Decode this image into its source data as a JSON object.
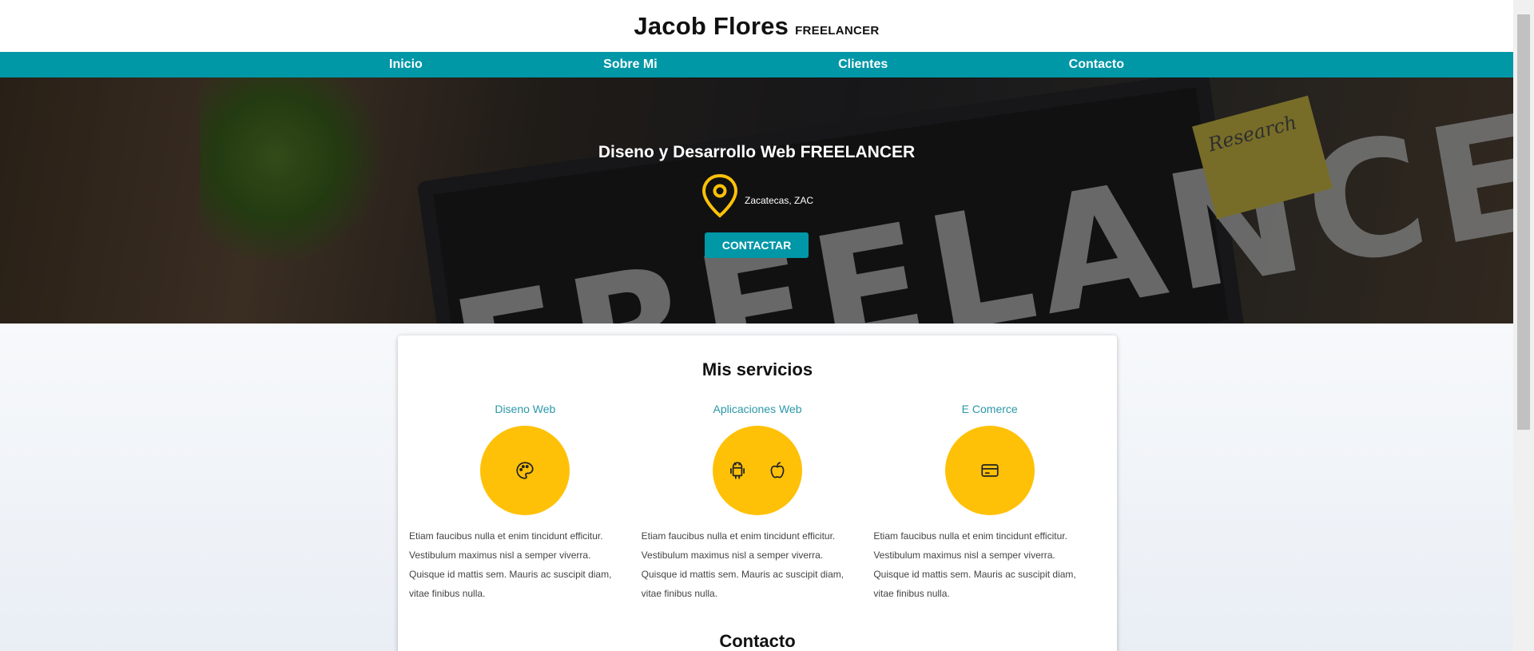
{
  "header": {
    "name": "Jacob Flores",
    "tag": "FREELANCER"
  },
  "nav": {
    "items": [
      "Inicio",
      "Sobre Mi",
      "Clientes",
      "Contacto"
    ]
  },
  "hero": {
    "title": "Diseno y Desarrollo Web FREELANCER",
    "location": "Zacatecas, ZAC",
    "cta": "CONTACTAR",
    "background_word": "FREELANCE",
    "note_word": "Research"
  },
  "services": {
    "title": "Mis servicios",
    "items": [
      {
        "title": "Diseno Web",
        "icons": [
          "palette-icon"
        ],
        "text": "Etiam faucibus nulla et enim tincidunt efficitur. Vestibulum maximus nisl a semper viverra. Quisque id mattis sem. Mauris ac suscipit diam, vitae finibus nulla."
      },
      {
        "title": "Aplicaciones Web",
        "icons": [
          "android-icon",
          "apple-icon"
        ],
        "text": "Etiam faucibus nulla et enim tincidunt efficitur. Vestibulum maximus nisl a semper viverra. Quisque id mattis sem. Mauris ac suscipit diam, vitae finibus nulla."
      },
      {
        "title": "E Comerce",
        "icons": [
          "credit-card-icon"
        ],
        "text": "Etiam faucibus nulla et enim tincidunt efficitur. Vestibulum maximus nisl a semper viverra. Quisque id mattis sem. Mauris ac suscipit diam, vitae finibus nulla."
      }
    ]
  },
  "contact": {
    "title": "Contacto"
  },
  "colors": {
    "accent": "#0097a7",
    "circle": "#ffc107",
    "service_title": "#2a98a8"
  }
}
